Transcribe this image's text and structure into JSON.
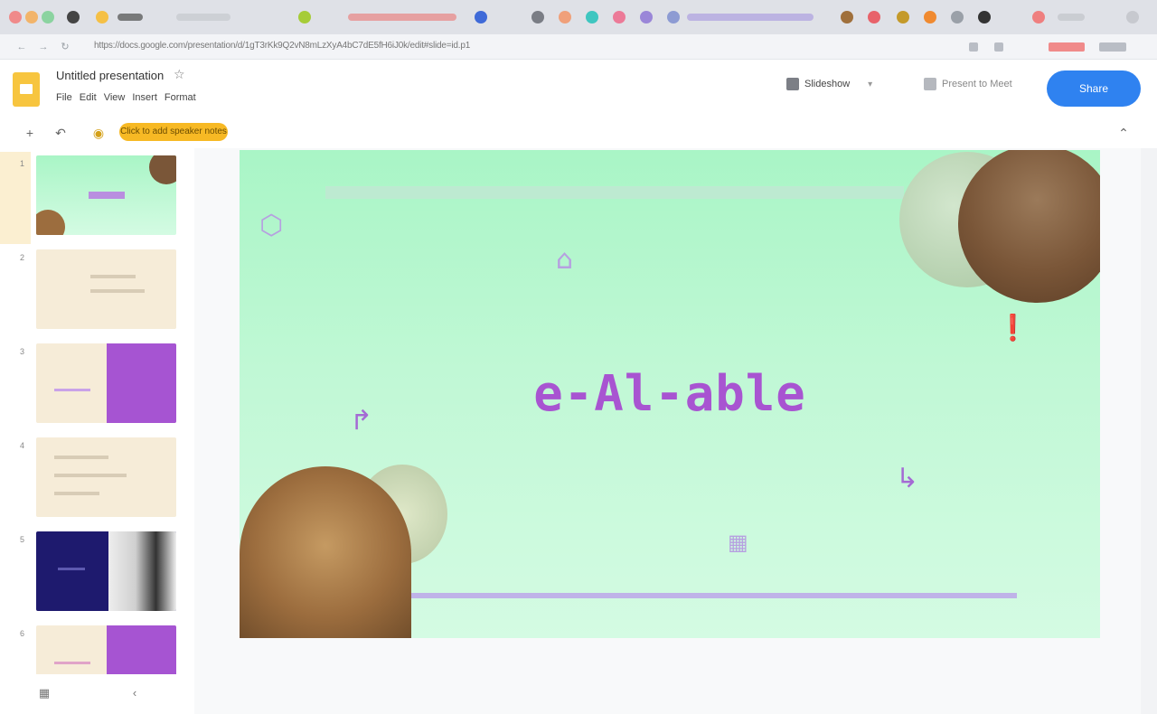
{
  "browser": {
    "url": "https://docs.google.com/presentation/d/1gT3rKk9Q2vN8mLzXyA4bC7dE5fH6iJ0k/edit#slide=id.p1"
  },
  "app": {
    "title": "Untitled presentation",
    "menus": [
      "File",
      "Edit",
      "View",
      "Insert",
      "Format"
    ],
    "header_buttons": {
      "slideshow": "Slideshow",
      "present_options": "Present to Meet",
      "share": "Share"
    },
    "toolbar": {
      "highlight_pill": "Click to add speaker notes"
    }
  },
  "filmstrip": {
    "slide_numbers": [
      "1",
      "2",
      "3",
      "4",
      "5",
      "6"
    ]
  },
  "slide": {
    "title": "e-Al‑able"
  },
  "colors": {
    "accent": "#a854d1",
    "share_button": "#2f82f0",
    "logo": "#f7c53f",
    "slide_bg": "#c0f8d5"
  }
}
